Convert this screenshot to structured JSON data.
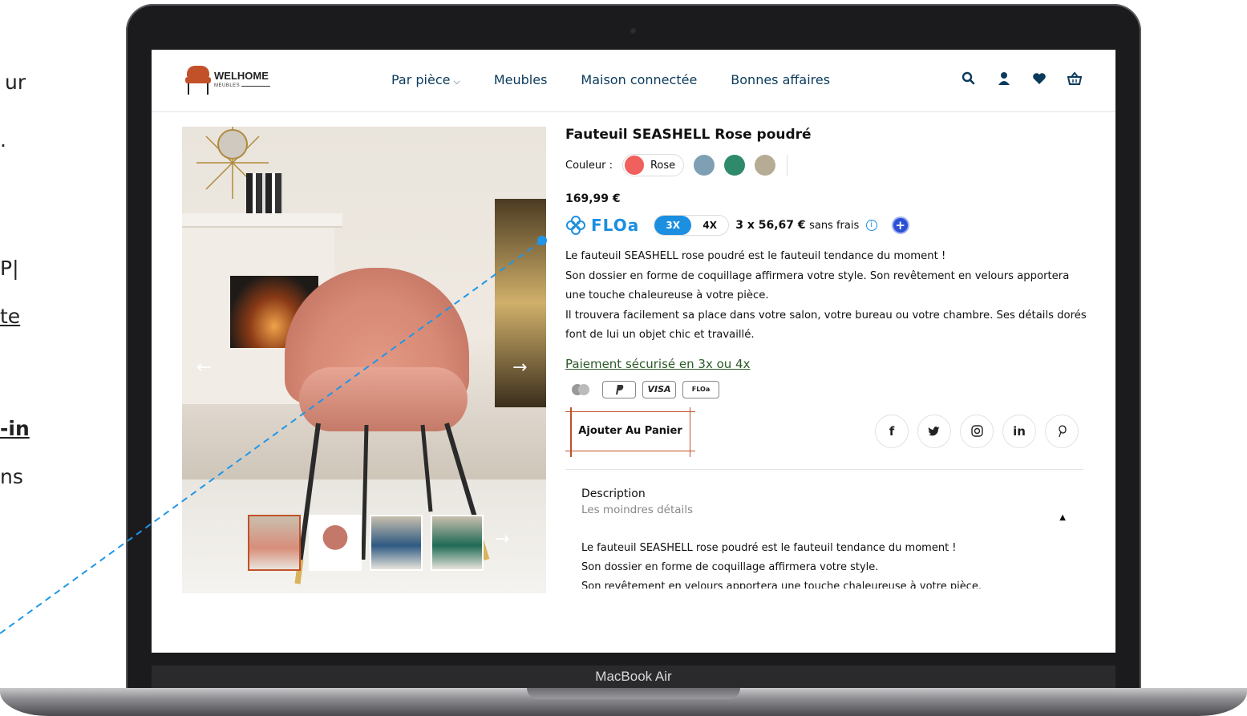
{
  "left_fragments": [
    "ur",
    ".",
    "P|",
    "te",
    "-in",
    "ns"
  ],
  "device_label": "MacBook Air",
  "header": {
    "logo_name": "WELHOME",
    "logo_sub": "MEUBLES",
    "nav": [
      {
        "label": "Par pièce",
        "has_dropdown": true
      },
      {
        "label": "Meubles"
      },
      {
        "label": "Maison connectée"
      },
      {
        "label": "Bonnes affaires"
      }
    ],
    "icons": [
      "search-icon",
      "user-icon",
      "heart-icon",
      "basket-icon"
    ]
  },
  "product": {
    "title": "Fauteuil SEASHELL Rose poudré",
    "color_label": "Couleur :",
    "selected_color": "Rose",
    "colors": [
      "#f0605c",
      "#7f9fb5",
      "#2f8a6c",
      "#b6ab95"
    ],
    "price": "169,99 €",
    "floa": {
      "brand": "FLOa",
      "options": [
        "3X",
        "4X"
      ],
      "selected": "3X",
      "installment": "3 x 56,67 €",
      "suffix": "sans frais"
    },
    "description_lines": [
      "Le fauteuil SEASHELL rose poudré est le fauteuil tendance du moment !",
      "Son dossier en forme de coquillage affirmera votre style. Son revêtement en velours apportera une touche chaleureuse à votre pièce.",
      "Il trouvera facilement sa place dans votre salon, votre bureau ou votre chambre. Ses détails dorés font de lui un objet chic et travaillé."
    ],
    "secure_payment_link": "Paiement sécurisé en 3x ou 4x",
    "payment_cards": [
      "VISA",
      "FLOa"
    ],
    "add_to_cart": "Ajouter Au Panier",
    "socials": [
      "f",
      "in"
    ],
    "accordion": {
      "title": "Description",
      "subtitle": "Les moindres détails",
      "body_lines": [
        "Le fauteuil SEASHELL rose poudré est le fauteuil tendance du moment !",
        "Son dossier en forme de coquillage affirmera votre style.",
        "Son revêtement en velours apportera une touche chaleureuse à votre pièce."
      ]
    }
  },
  "colors": {
    "brand": "#c2512a",
    "nav_text": "#0b3b5c",
    "floa_blue": "#1c8fe0",
    "annotation": "#1f96e8"
  }
}
